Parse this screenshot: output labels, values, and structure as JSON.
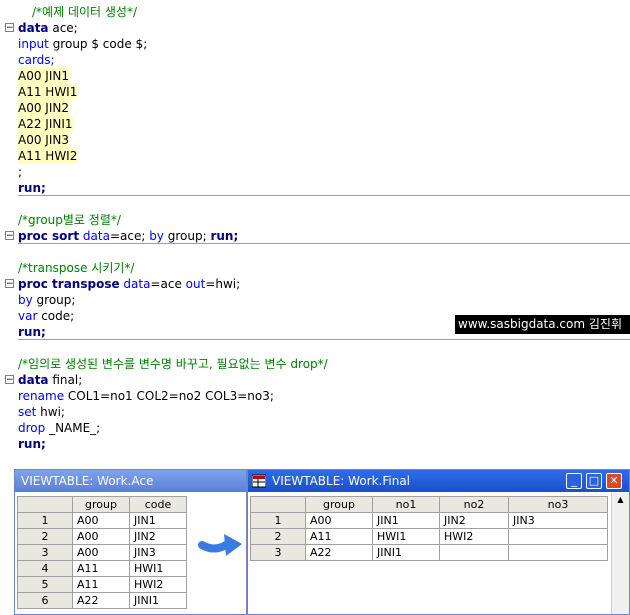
{
  "code": {
    "comment1": "/*예제 데이터 생성*/",
    "data_kw": "data",
    "data_name": " ace;",
    "input_kw": "input",
    "input_rest": " group $ code $;",
    "cards_kw": "cards;",
    "cards_lines": [
      "A00 JIN1",
      "A11 HWI1",
      "A00 JIN2",
      "A22 JINI1",
      "A00 JIN3",
      "A11 HWI2"
    ],
    "semicolon": ";",
    "run_kw": "run;",
    "comment2": "/*group별로 정렬*/",
    "proc_sort_kw": "proc sort",
    "sort_data_kw": " data",
    "sort_data_val": "=ace; ",
    "sort_by_kw": "by",
    "sort_by_val": " group; ",
    "sort_run_kw": "run;",
    "comment3": "/*transpose 시키기*/",
    "proc_transpose_kw": "proc transpose",
    "tr_data_kw": " data",
    "tr_data_val": "=ace ",
    "tr_out_kw": "out",
    "tr_out_val": "=hwi;",
    "by_kw": "by",
    "by_val": " group;",
    "var_kw": "var",
    "var_val": " code;",
    "tr_run_kw": "run;",
    "comment4": "/*임의로 생성된 변수를 변수명 바꾸고, 필요없는 변수 drop*/",
    "data2_kw": "data",
    "data2_name": " final;",
    "rename_kw": "rename",
    "rename_val": " COL1=no1 COL2=no2 COL3=no3;",
    "set_kw": "set",
    "set_val": " hwi;",
    "drop_kw": "drop",
    "drop_val": " _NAME_;",
    "final_run_kw": "run;"
  },
  "watermark": "www.sasbigdata.com 김진휘",
  "window_ace": {
    "title": "VIEWTABLE: Work.Ace",
    "columns": [
      "group",
      "code"
    ],
    "rows": [
      {
        "n": "1",
        "cells": [
          "A00",
          "JIN1"
        ]
      },
      {
        "n": "2",
        "cells": [
          "A00",
          "JIN2"
        ]
      },
      {
        "n": "3",
        "cells": [
          "A00",
          "JIN3"
        ]
      },
      {
        "n": "4",
        "cells": [
          "A11",
          "HWI1"
        ]
      },
      {
        "n": "5",
        "cells": [
          "A11",
          "HWI2"
        ]
      },
      {
        "n": "6",
        "cells": [
          "A22",
          "JINI1"
        ]
      }
    ]
  },
  "window_final": {
    "title": "VIEWTABLE: Work.Final",
    "columns": [
      "group",
      "no1",
      "no2",
      "no3"
    ],
    "rows": [
      {
        "n": "1",
        "cells": [
          "A00",
          "JIN1",
          "JIN2",
          "JIN3"
        ]
      },
      {
        "n": "2",
        "cells": [
          "A11",
          "HWI1",
          "HWI2",
          ""
        ]
      },
      {
        "n": "3",
        "cells": [
          "A22",
          "JINI1",
          "",
          ""
        ]
      }
    ]
  },
  "icons": {
    "fold": "collapse-box-icon",
    "arrow": "right-arrow-icon",
    "minimize": "minimize-icon",
    "maximize": "maximize-icon",
    "close": "close-icon",
    "scroll_up": "scroll-up-arrow-icon",
    "app": "viewtable-app-icon"
  },
  "colors": {
    "comment": "#008000",
    "keyword": "#000080",
    "option": "#0000ff",
    "datalines_bg": "#ffffc0",
    "titlebar_active": "#1a4fc7",
    "arrow": "#3a7be0"
  }
}
